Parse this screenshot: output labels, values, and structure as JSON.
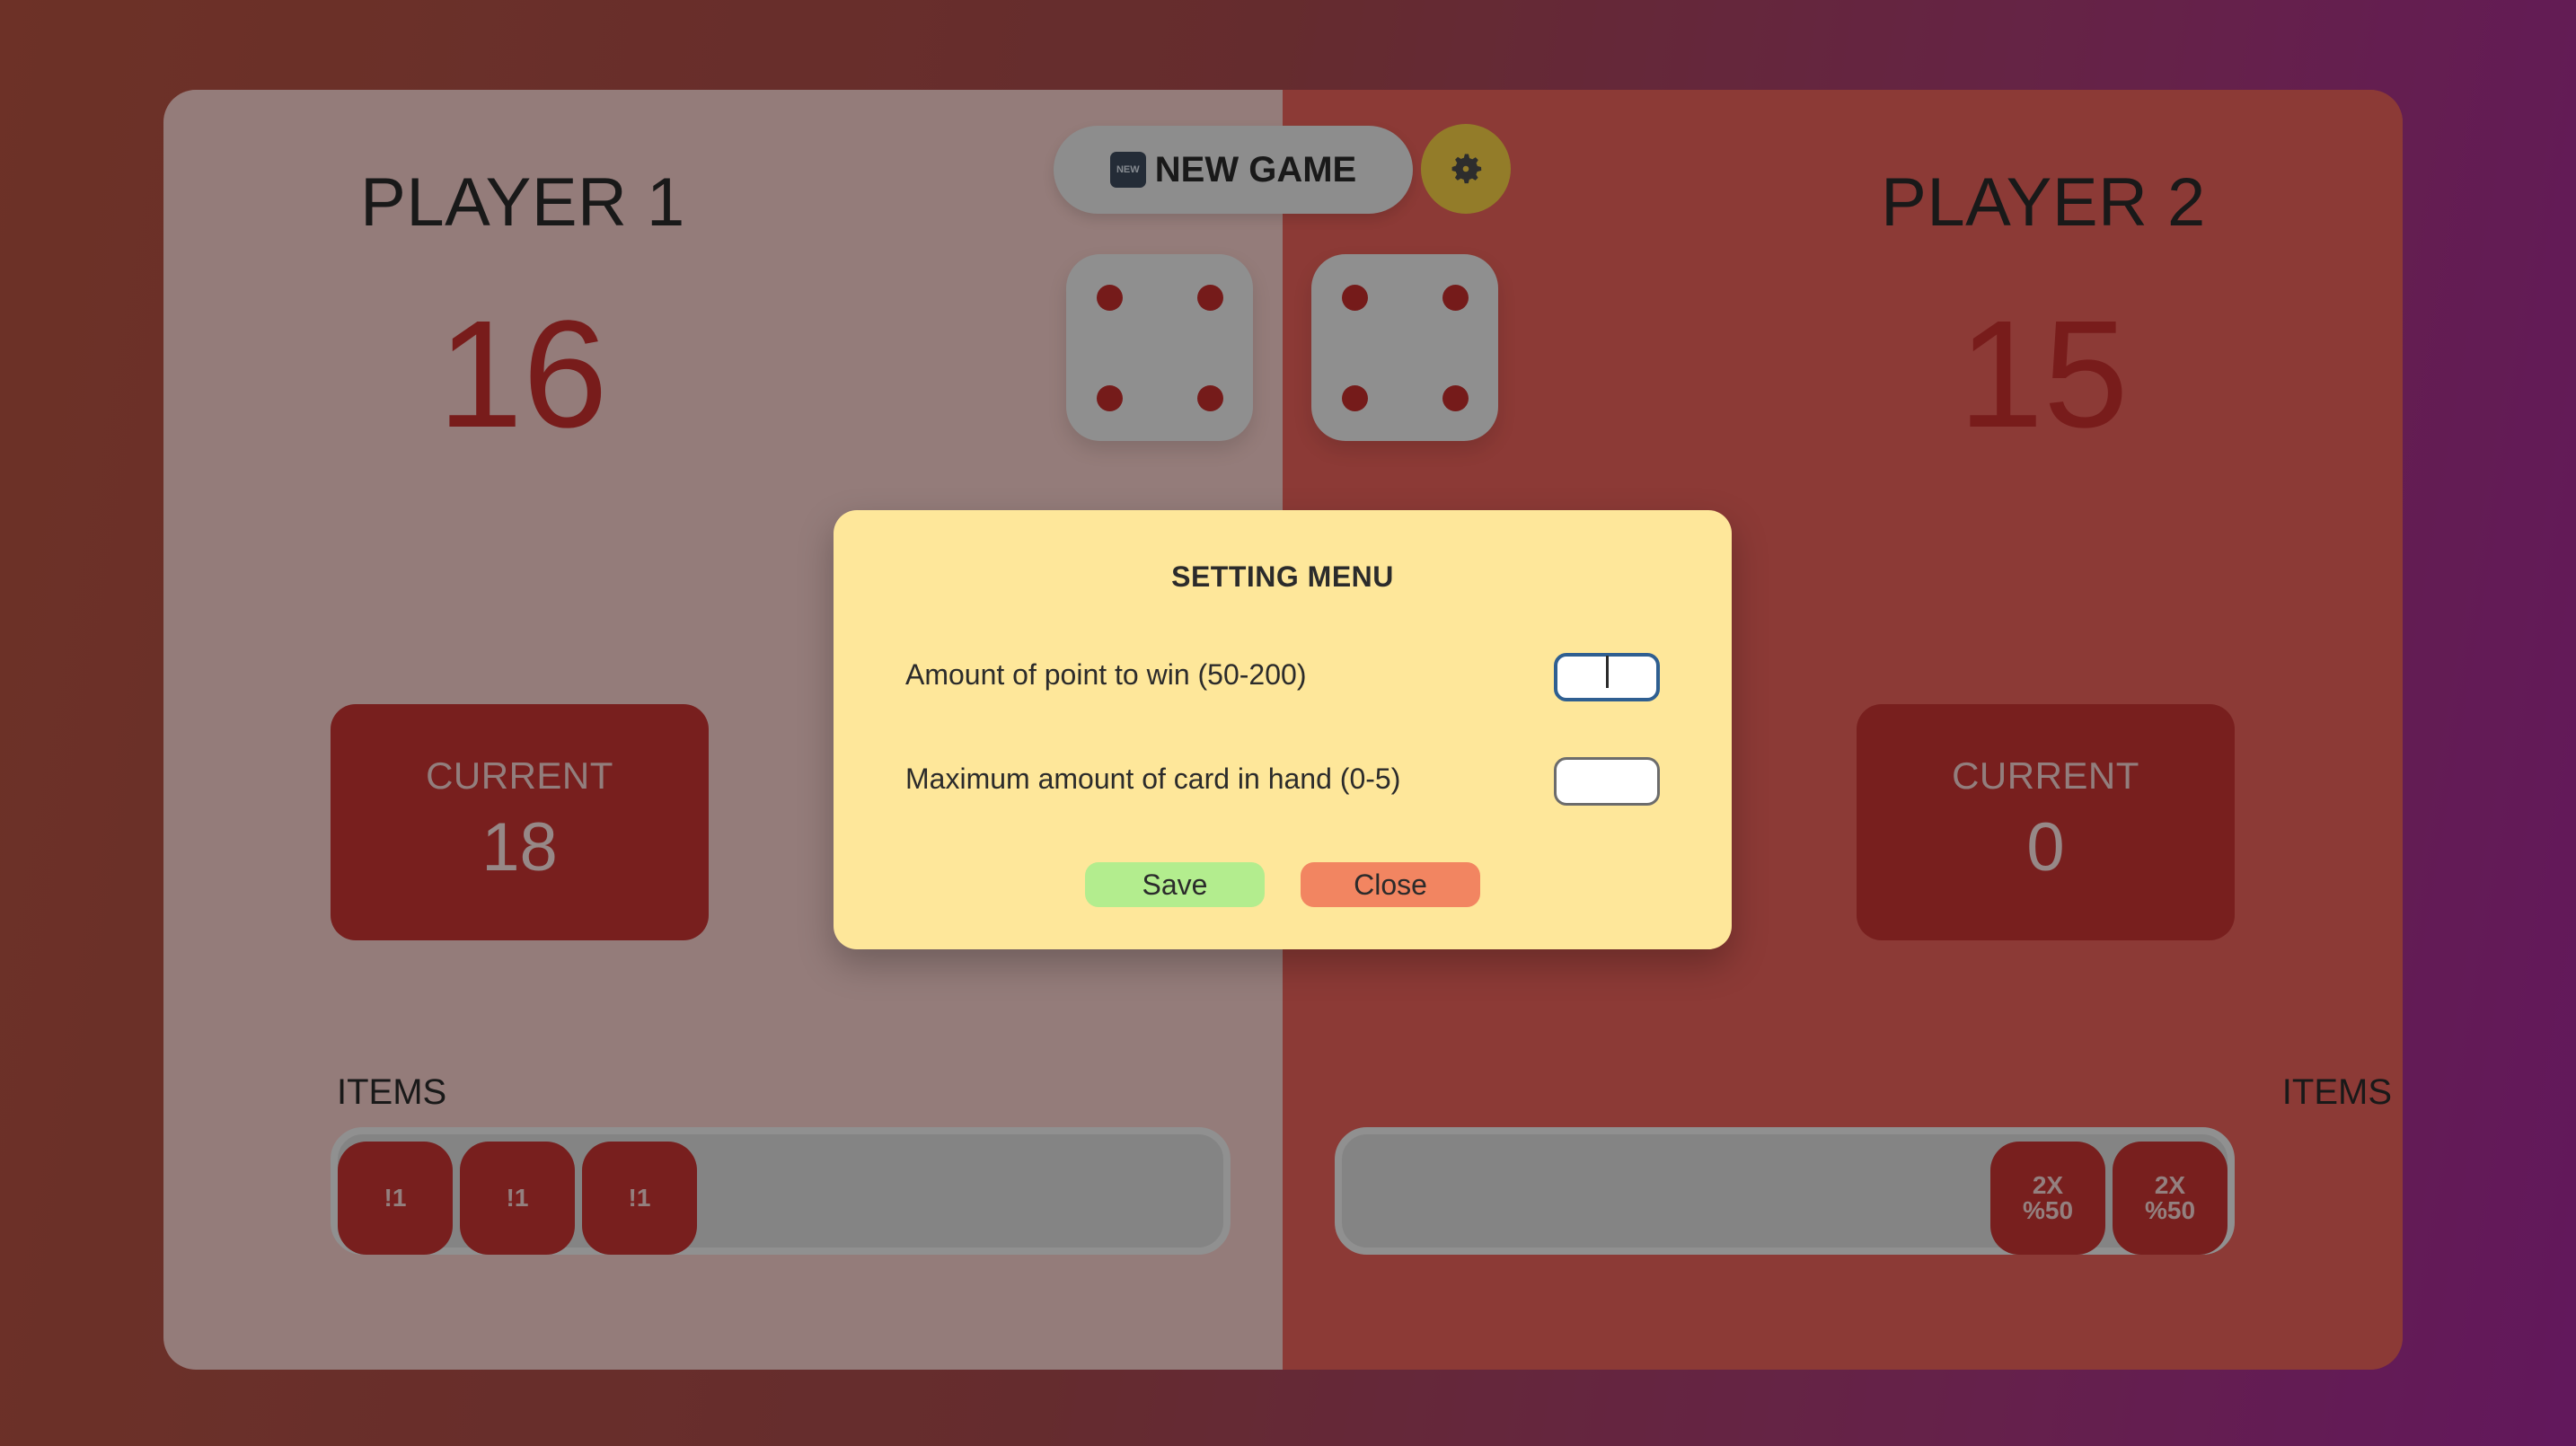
{
  "header": {
    "new_game_emoji": "NEW",
    "new_game_label": "NEW GAME",
    "settings_icon": "gear-icon"
  },
  "players": [
    {
      "name": "PLAYER 1",
      "score": "16",
      "current_label": "CURRENT",
      "current_value": "18",
      "items_label": "ITEMS",
      "items": [
        "!1",
        "!1",
        "!1"
      ]
    },
    {
      "name": "PLAYER 2",
      "score": "15",
      "current_label": "CURRENT",
      "current_value": "0",
      "items_label": "ITEMS",
      "items": [
        "2X\n%50",
        "2X\n%50"
      ]
    }
  ],
  "dice": [
    4,
    4
  ],
  "modal": {
    "title": "SETTING MENU",
    "settings": [
      {
        "label": "Amount of point to win (50-200)",
        "value": ""
      },
      {
        "label": "Maximum amount of card in hand (0-5)",
        "value": ""
      }
    ],
    "save_label": "Save",
    "close_label": "Close"
  },
  "colors": {
    "accent_red": "#c83433",
    "modal_bg": "#fee79a",
    "save_green": "#b3ed8e",
    "close_orange": "#f28561",
    "gear_yellow": "#f5cf45"
  }
}
